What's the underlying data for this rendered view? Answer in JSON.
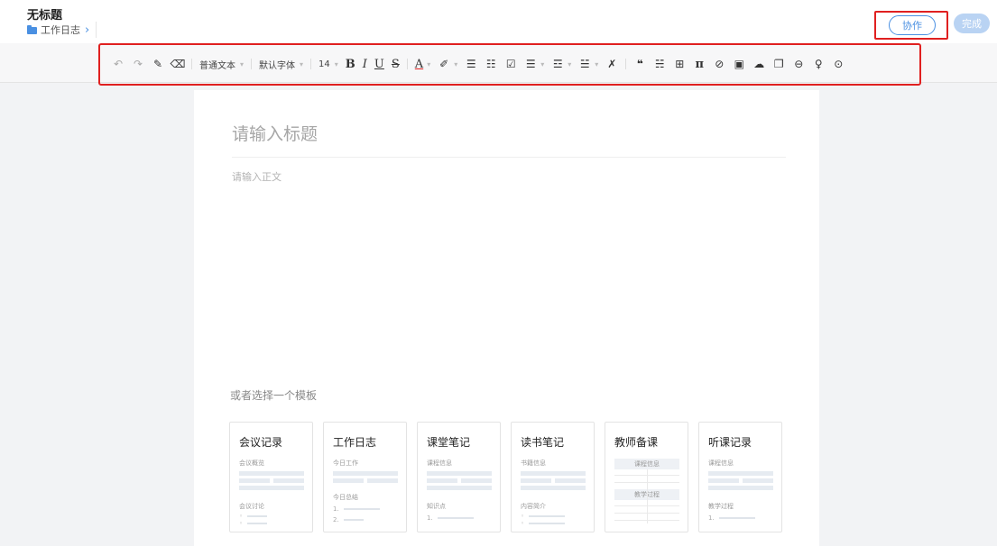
{
  "header": {
    "title": "无标题",
    "breadcrumb": "工作日志",
    "collab_label": "协作",
    "done_label": "完成"
  },
  "toolbar": {
    "undo": "↶",
    "redo": "↷",
    "format_painter": "✎",
    "clear_format": "⌫",
    "paragraph_style": "普通文本",
    "font_family": "默认字体",
    "font_size": "14",
    "bold": "B",
    "italic": "I",
    "underline": "U",
    "strikethrough": "S",
    "font_color": "A",
    "highlight": "✐",
    "bullet_list": "☰",
    "numbered_list": "☷",
    "checklist": "☑",
    "align": "☰",
    "indent": "☲",
    "line_height": "☱",
    "clear": "✗",
    "quote": "❝",
    "divider": "☵",
    "table": "⊞",
    "formula": "π",
    "attachment": "⊘",
    "image": "▣",
    "cloud": "☁",
    "copy": "❐",
    "link": "⊖",
    "voice": "♀",
    "more": "⊙"
  },
  "editor": {
    "title_placeholder": "请输入标题",
    "body_placeholder": "请输入正文",
    "template_heading": "或者选择一个模板"
  },
  "templates": [
    {
      "title": "会议记录",
      "sub1": "会议概览",
      "sub2": "会议讨论"
    },
    {
      "title": "工作日志",
      "sub1": "今日工作",
      "sub2": "今日总结"
    },
    {
      "title": "课堂笔记",
      "sub1": "课程信息",
      "sub2": "知识点"
    },
    {
      "title": "读书笔记",
      "sub1": "书籍信息",
      "sub2": "内容简介"
    },
    {
      "title": "教师备课",
      "sub1": "课程信息",
      "sub2": "教学过程"
    },
    {
      "title": "听课记录",
      "sub1": "课程信息",
      "sub2": "教学过程"
    }
  ],
  "list_markers": {
    "bullet": "◦",
    "n1": "1.",
    "n2": "2."
  },
  "colors": {
    "accent": "#4a90e2",
    "highlight_box": "#e02020",
    "done_disabled": "#b9d3f3"
  }
}
